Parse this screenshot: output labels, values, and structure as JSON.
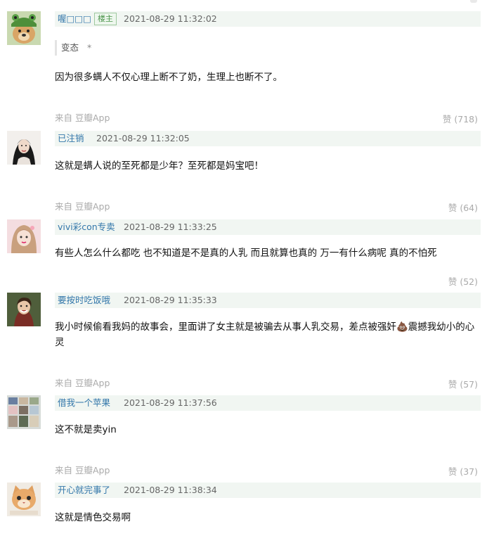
{
  "comments": [
    {
      "username": "喔□□□",
      "badge": "楼主",
      "time": "2021-08-29 11:32:02",
      "quote": "变态",
      "quote_mark": "*",
      "text": "因为很多螨人不仅心理上断不了奶，生理上也断不了。",
      "source": "来自 豆瓣App",
      "likes": "赞 (718)"
    },
    {
      "username": "已注销",
      "time": "2021-08-29 11:32:05",
      "text": "这就是螨人说的至死都是少年？至死都是妈宝吧！",
      "source": "来自 豆瓣App",
      "likes": "赞 (64)"
    },
    {
      "username": "vivi彩con专卖",
      "time": "2021-08-29 11:33:25",
      "text": "有些人怎么什么都吃 也不知道是不是真的人乳 而且就算也真的 万一有什么病呢 真的不怕死",
      "likes": "赞 (52)"
    },
    {
      "username": "要按时吃饭哦",
      "time": "2021-08-29 11:35:33",
      "text": "我小时候偷看我妈的故事会，里面讲了女主就是被骗去从事人乳交易，差点被强奸💩震撼我幼小的心灵",
      "source": "来自 豆瓣App",
      "likes": "赞 (57)"
    },
    {
      "username": "借我一个苹果",
      "time": "2021-08-29 11:37:56",
      "text": "这不就是卖yin",
      "source": "来自 豆瓣App",
      "likes": "赞 (37)"
    },
    {
      "username": "开心就完事了",
      "time": "2021-08-29 11:38:34",
      "text": "这就是情色交易啊"
    }
  ],
  "colors": {
    "meta_bar_bg": "#f1f6f2",
    "username": "#3377aa",
    "muted": "#aaaaaa"
  }
}
